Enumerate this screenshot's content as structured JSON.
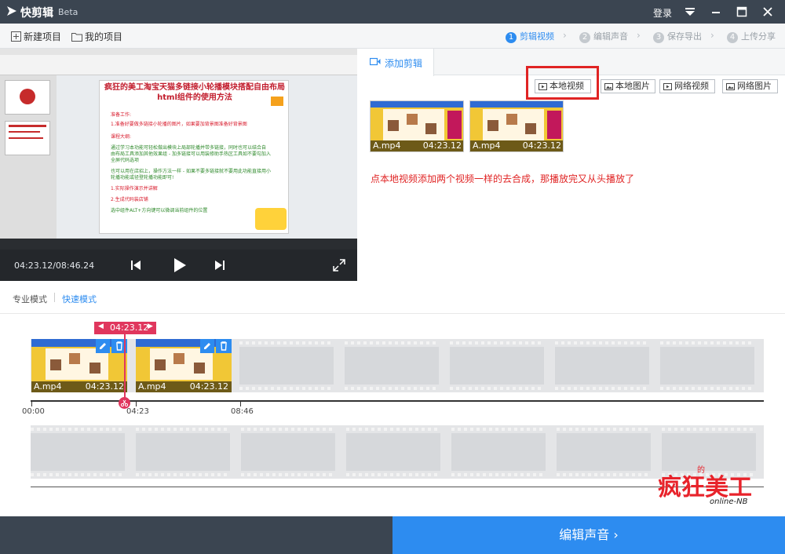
{
  "titlebar": {
    "app_name": "快剪辑",
    "beta": "Beta",
    "login": "登录"
  },
  "menubar": {
    "new_project": "新建项目",
    "my_projects": "我的项目",
    "steps": [
      {
        "num": "1",
        "label": "剪辑视频"
      },
      {
        "num": "2",
        "label": "编辑声音"
      },
      {
        "num": "3",
        "label": "保存导出"
      },
      {
        "num": "4",
        "label": "上传分享"
      }
    ]
  },
  "preview": {
    "doc_title_1": "疯狂的美工淘宝天猫多链接小轮播模块搭配自由布局",
    "doc_title_2": "html组件的使用方法",
    "doc_lines": [
      "准备工作:",
      "1.准备好要做多链接小轮播的图片，如果要加背景图准备好背景图",
      "课程大纲:",
      "通过学习本功能可轻松做出模块上局部轮播并带多链接，同时也可以结合自",
      "由布局工具添加其他效果组 - 加多链接可以用装修助手热区工具如不要勾加入",
      "全屏代码选项",
      "也可以用在店招上，操作方法一样 - 如果不要多链接就不要用此功能直接用小",
      "轮播功能或径登轮播功能即可!",
      "1.实际操作演示并讲解",
      "2.生成代码装店铺",
      "选中组件ALT+方向键可以微调当前组件的位置"
    ],
    "time": "04:23.12/08:46.24"
  },
  "right": {
    "tab_label": "添加剪辑",
    "buttons": {
      "local_video": "本地视频",
      "local_image": "本地图片",
      "web_video": "网络视频",
      "web_image": "网络图片"
    },
    "clips": [
      {
        "name": "A.mp4",
        "duration": "04:23.12"
      },
      {
        "name": "A.mp4",
        "duration": "04:23.12"
      }
    ],
    "annotation": "点本地视频添加两个视频一样的去合成，那播放完又从头播放了"
  },
  "modes": {
    "pro": "专业模式",
    "quick": "快速模式"
  },
  "timeline": {
    "playhead_time": "04:23.12",
    "clips": [
      {
        "name": "A.mp4",
        "duration": "04:23.12"
      },
      {
        "name": "A.mp4",
        "duration": "04:23.12"
      }
    ],
    "ticks": [
      "00:00",
      "04:23",
      "08:46"
    ]
  },
  "watermark": {
    "main": "疯狂美工",
    "small_de": "的",
    "sub": "online-NB"
  },
  "bottom": {
    "next": "编辑声音 ›"
  },
  "colors": {
    "accent": "#2d8cf0",
    "titlebar": "#3b4551",
    "highlight": "#e02424",
    "playhead": "#e0365d"
  }
}
